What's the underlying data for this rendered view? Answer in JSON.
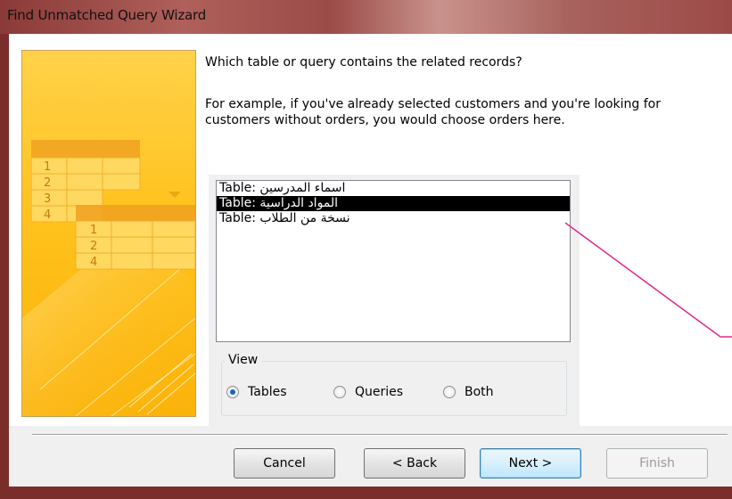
{
  "window": {
    "title": "Find Unmatched Query Wizard"
  },
  "wizard": {
    "prompt": "Which table or query contains the related records?",
    "example": "For example, if you've already selected customers and you're looking for customers without orders, you would choose orders here."
  },
  "list": {
    "items": [
      {
        "prefix": "Table: ",
        "name": "اسماء المدرسين",
        "selected": false
      },
      {
        "prefix": "Table: ",
        "name": "المواد الدراسية",
        "selected": true
      },
      {
        "prefix": "Table: ",
        "name": "نسخة من  الطلاب",
        "selected": false
      }
    ]
  },
  "view": {
    "label": "View",
    "options": [
      {
        "label": "Tables",
        "checked": true
      },
      {
        "label": "Queries",
        "checked": false
      },
      {
        "label": "Both",
        "checked": false
      }
    ]
  },
  "buttons": {
    "cancel": "Cancel",
    "back": "< Back",
    "next": "Next >",
    "finish": "Finish"
  },
  "illustration": {
    "rows_left": [
      "1",
      "2",
      "3",
      "4"
    ],
    "rows_right": [
      "1",
      "2",
      "4"
    ]
  },
  "colors": {
    "selection": "#000000",
    "accent_line": "#e0288c",
    "art_bg": "#ffc21c"
  }
}
